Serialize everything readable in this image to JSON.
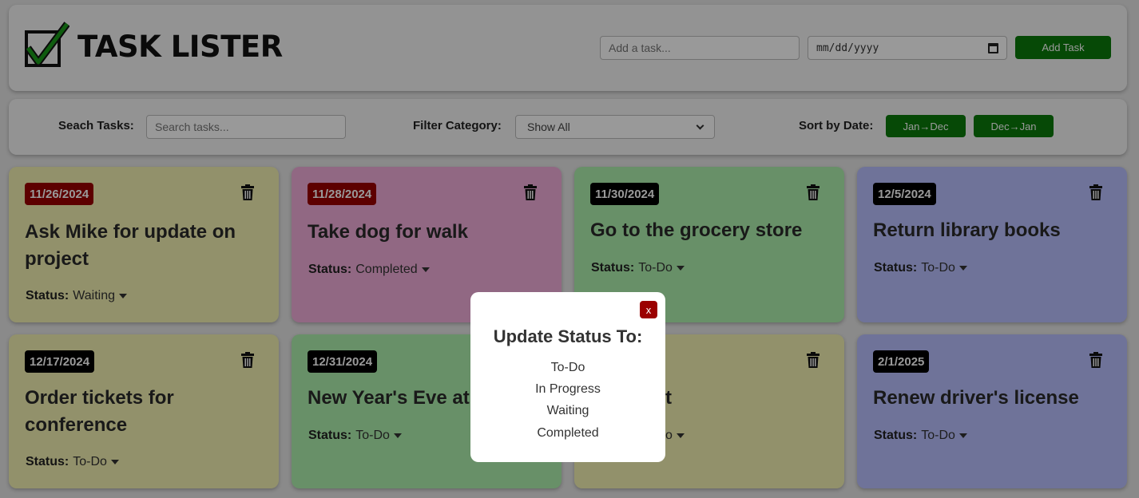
{
  "app": {
    "title": "TASK LISTER"
  },
  "add_form": {
    "task_placeholder": "Add a task...",
    "date_placeholder": "mm/dd/yyyy",
    "add_label": "Add Task"
  },
  "toolbar": {
    "search_label": "Seach Tasks:",
    "search_placeholder": "Search tasks...",
    "filter_label": "Filter Category:",
    "filter_value": "Show All",
    "sort_label": "Sort by Date:",
    "sort_asc_label": "Jan→Dec",
    "sort_desc_label": "Dec→Jan"
  },
  "status_label": "Status:",
  "tasks": [
    {
      "date": "11/26/2024",
      "title": "Ask Mike for update on project",
      "status": "Waiting",
      "color": "#f4f2b3",
      "overdue": true
    },
    {
      "date": "11/28/2024",
      "title": "Take dog for walk",
      "status": "Completed",
      "color": "#f2aedb",
      "overdue": true
    },
    {
      "date": "11/30/2024",
      "title": "Go to the grocery store",
      "status": "To-Do",
      "color": "#aef0ad",
      "overdue": false
    },
    {
      "date": "12/5/2024",
      "title": "Return library books",
      "status": "To-Do",
      "color": "#b9c0ff",
      "overdue": false
    },
    {
      "date": "12/17/2024",
      "title": "Order tickets for conference",
      "status": "To-Do",
      "color": "#f4f2b3",
      "overdue": false
    },
    {
      "date": "12/31/2024",
      "title": "New Year's Eve at",
      "status": "To-Do",
      "color": "#aef0ad",
      "overdue": false
    },
    {
      "date": "",
      "title": "t",
      "status": "o",
      "color": "#f4f2b3",
      "overdue": false
    },
    {
      "date": "2/1/2025",
      "title": "Renew driver's license",
      "status": "To-Do",
      "color": "#b9c0ff",
      "overdue": false
    }
  ],
  "modal": {
    "close_label": "x",
    "title": "Update Status To:",
    "options": [
      "To-Do",
      "In Progress",
      "Waiting",
      "Completed"
    ]
  },
  "colors": {
    "accent": "#0a7a0a",
    "overdue": "#9b0000",
    "logo_check": "#1a9a1a"
  }
}
